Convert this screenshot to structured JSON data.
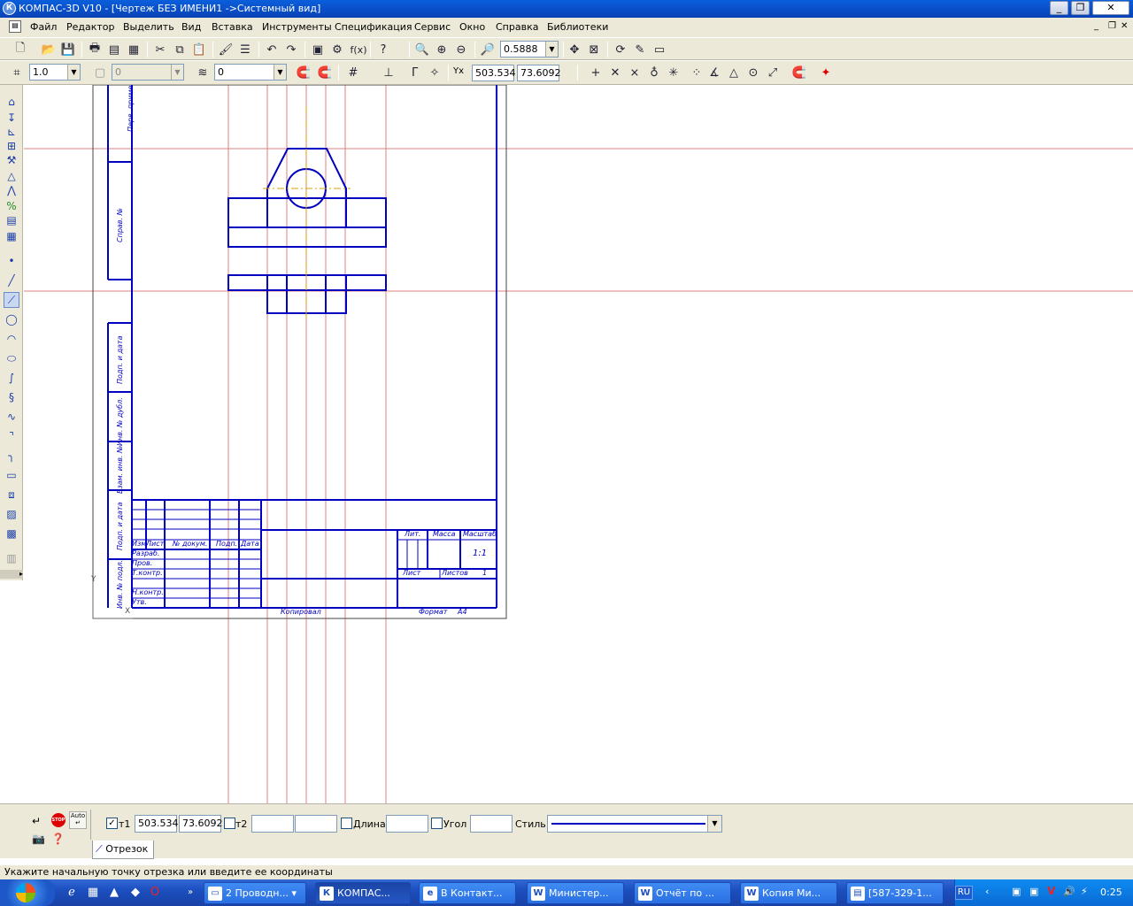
{
  "window": {
    "title": "КОМПАС-3D V10 - [Чертеж БЕЗ ИМЕНИ1 ->Системный вид]",
    "app_icon": "К"
  },
  "menu": [
    "Файл",
    "Редактор",
    "Выделить",
    "Вид",
    "Вставка",
    "Инструменты",
    "Спецификация",
    "Сервис",
    "Окно",
    "Справка",
    "Библиотеки"
  ],
  "toolbar1": {
    "zoom_value": "0.5888",
    "fx_label": "f(x)"
  },
  "toolbar2": {
    "scale_value": "1.0",
    "disabled_value": "0",
    "layer_value": "0",
    "cursor_x": "503.534",
    "cursor_y": "73.6092"
  },
  "drawing": {
    "side_labels": [
      "Перв. примен.",
      "Справ. №",
      "Подп. и дата",
      "Инв. № дубл.",
      "Взам. инв. №",
      "Подп. и дата",
      "Инв. № подл."
    ],
    "title_block": {
      "col_headers": [
        "Изм",
        "Лист",
        "№ докум.",
        "Подп.",
        "Дата"
      ],
      "rows": [
        "Разраб.",
        "Пров.",
        "Т.контр.",
        "Н.контр.",
        "Утв."
      ],
      "lit": "Лит.",
      "mass": "Масса",
      "scale_hdr": "Масштаб",
      "scale": "1:1",
      "sheet": "Лист",
      "sheets": "Листов",
      "sheets_n": "1",
      "copied": "Копировал",
      "format": "Формат",
      "format_v": "A4"
    }
  },
  "bottom": {
    "t1_label": "т1",
    "t1_x": "503.534",
    "t1_y": "73.6092",
    "t2_label": "т2",
    "length_label": "Длина",
    "angle_label": "Угол",
    "style_label": "Стиль",
    "tab_label": "Отрезок",
    "auto_label": "Auto",
    "stop_label": "STOP"
  },
  "status_text": "Укажите начальную точку отрезка или введите ее координаты",
  "taskbar": {
    "tasks": [
      {
        "label": "2 Проводн...",
        "icon": "folder-icon"
      },
      {
        "label": "КОМПАС...",
        "icon": "kompas-icon"
      },
      {
        "label": "В Контакт...",
        "icon": "ie-icon"
      },
      {
        "label": "Министер...",
        "icon": "word-icon"
      },
      {
        "label": "Отчёт по ...",
        "icon": "word-icon"
      },
      {
        "label": "Копия Ми...",
        "icon": "word-icon"
      },
      {
        "label": "[587-329-1...",
        "icon": "app-icon"
      }
    ],
    "lang": "RU",
    "clock": "0:25"
  },
  "colors": {
    "drawing_blue": "#0000c0",
    "grid_red": "#e08080",
    "axis_orange": "#d4a000"
  }
}
